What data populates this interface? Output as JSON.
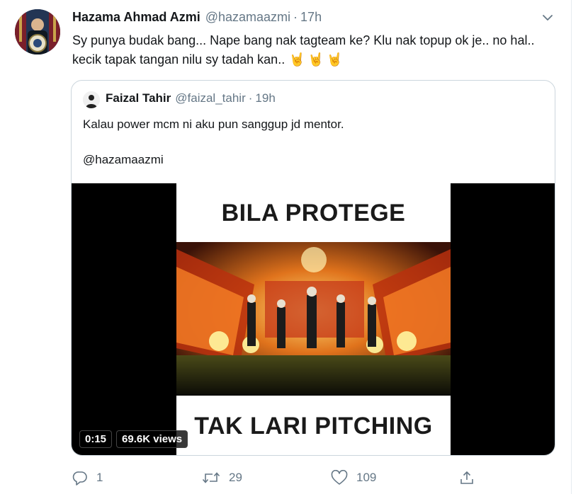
{
  "tweet": {
    "author_name": "Hazama Ahmad Azmi",
    "author_handle": "@hazamaazmi",
    "separator": "·",
    "time": "17h",
    "text": "Sy punya budak bang... Nape bang nak tagteam ke? Klu nak topup ok je.. no hal.. kecik tapak tangan nilu sy tadah kan..",
    "emojis": "🤘🤘🤘"
  },
  "quoted_tweet": {
    "author_name": "Faizal Tahir",
    "author_handle": "@faizal_tahir",
    "separator": "·",
    "time": "19h",
    "text": "Kalau power mcm ni aku pun sanggup jd mentor.",
    "mention": "@hazamaazmi",
    "video": {
      "caption_top": "BILA PROTEGE",
      "caption_bottom": "TAK LARI PITCHING",
      "duration": "0:15",
      "views": "69.6K views"
    }
  },
  "actions": {
    "reply_count": "1",
    "retweet_count": "29",
    "like_count": "109"
  },
  "colors": {
    "secondary_text": "#657786",
    "border": "#ccd6dd"
  },
  "icons": [
    "chevron-down-icon",
    "reply-icon",
    "retweet-icon",
    "like-icon",
    "share-icon"
  ]
}
